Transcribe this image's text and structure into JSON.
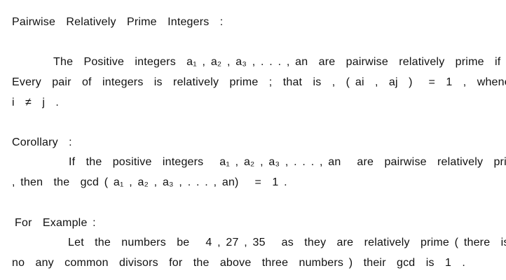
{
  "document": {
    "heading": "Pairwise  Relatively  Prime  Integers  :",
    "definition": {
      "line1": "The  Positive  integers  a₁ , a₂ , a₃ , . . . , an  are  pairwise  relatively  prime  if",
      "line2": "Every  pair  of  integers  is  relatively  prime  ;  that  is  ,  ( ai  ,  aj  )   =  1  ,  whenever",
      "line3": "i  ≠  j  ."
    },
    "corollary": {
      "heading": "Corollary  :",
      "line1": "If  the  positive  integers   a₁ , a₂ , a₃ , . . . , an   are  pairwise  relatively  prime",
      "line2": ", then  the  gcd ( a₁ , a₂ , a₃ , . . . , an)   =  1 ."
    },
    "example": {
      "heading": "For  Example :",
      "line1": "Let  the  numbers  be   4 , 27 , 35   as  they  are  relatively  prime ( there  is",
      "line2": "no  any  common  divisors  for  the  above  three  numbers )  their  gcd  is  1  ."
    }
  }
}
